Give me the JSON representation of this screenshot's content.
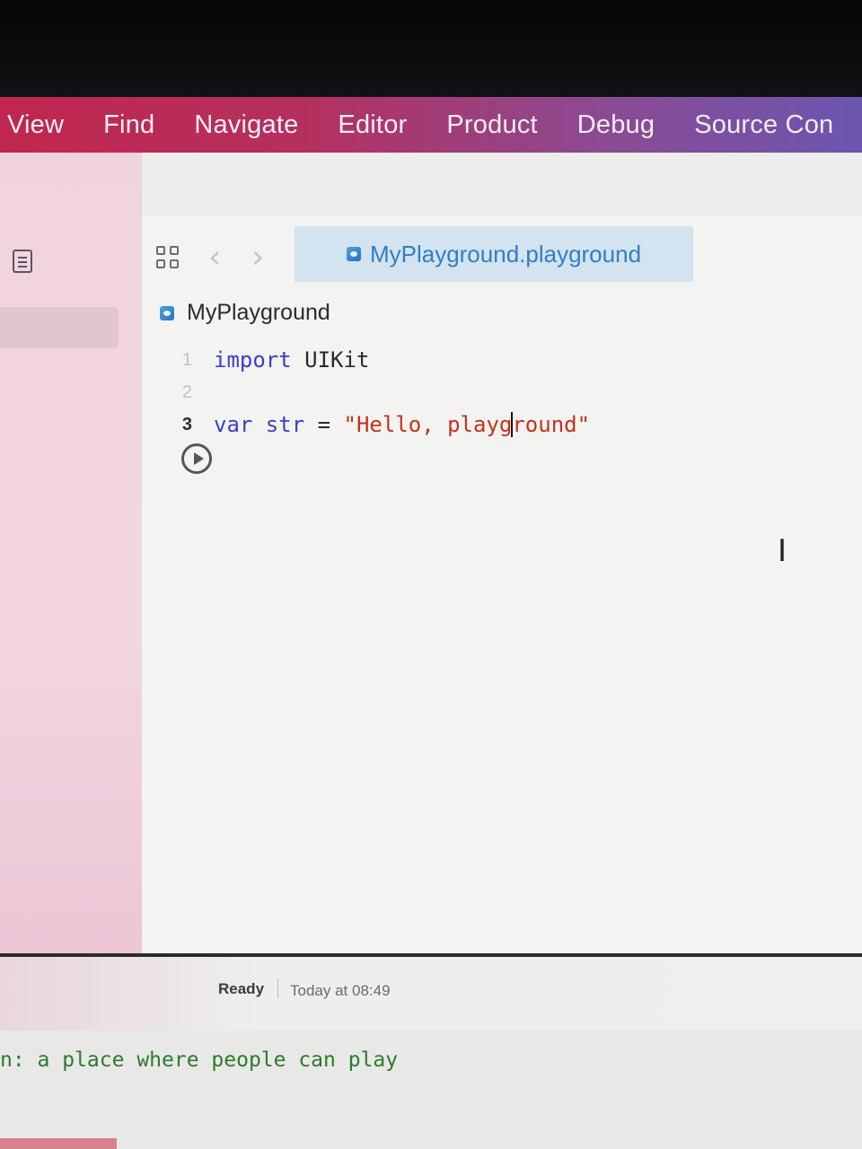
{
  "menubar": {
    "items": [
      "View",
      "Find",
      "Navigate",
      "Editor",
      "Product",
      "Debug",
      "Source Con"
    ]
  },
  "toolbar": {
    "tab_label": "MyPlayground.playground"
  },
  "jumpbar": {
    "label": "MyPlayground"
  },
  "code": {
    "line_numbers": [
      "1",
      "2",
      "3"
    ],
    "line1": {
      "keyword": "import",
      "rest": " UIKit"
    },
    "line3": {
      "keyword": "var",
      "ident": " str",
      "op": " = ",
      "str_before_caret": "\"Hello, playg",
      "str_after_caret": "round\""
    }
  },
  "status": {
    "state": "Ready",
    "time": "Today at 08:49"
  },
  "terminal": {
    "line": "n: a place where people can play"
  },
  "colors": {
    "menubar_start": "#c0264f",
    "menubar_end": "#6b56b0",
    "keyword": "#3b40c9",
    "string": "#c4331d",
    "tab_text": "#2d7fc8",
    "terminal_text": "#2e7a2e"
  }
}
